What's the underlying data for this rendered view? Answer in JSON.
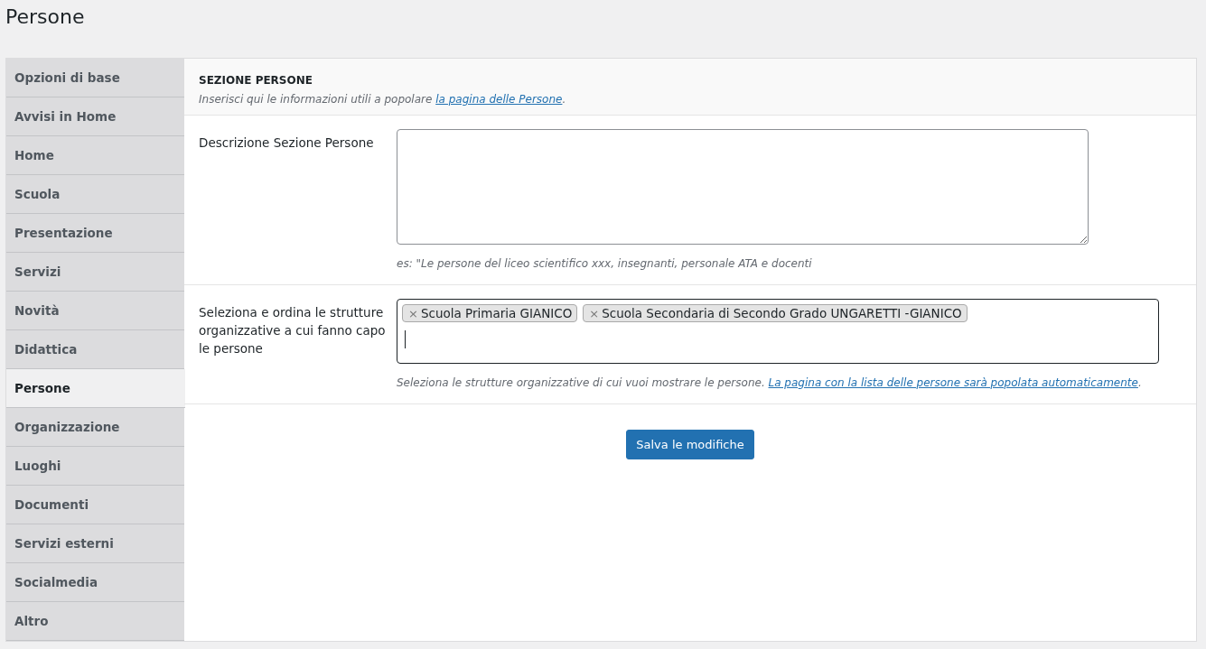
{
  "page_title": "Persone",
  "sidebar": {
    "items": [
      {
        "label": "Opzioni di base",
        "selected": false
      },
      {
        "label": "Avvisi in Home",
        "selected": false
      },
      {
        "label": "Home",
        "selected": false
      },
      {
        "label": "Scuola",
        "selected": false
      },
      {
        "label": "Presentazione",
        "selected": false
      },
      {
        "label": "Servizi",
        "selected": false
      },
      {
        "label": "Novità",
        "selected": false
      },
      {
        "label": "Didattica",
        "selected": false
      },
      {
        "label": "Persone",
        "selected": true
      },
      {
        "label": "Organizzazione",
        "selected": false
      },
      {
        "label": "Luoghi",
        "selected": false
      },
      {
        "label": "Documenti",
        "selected": false
      },
      {
        "label": "Servizi esterni",
        "selected": false
      },
      {
        "label": "Socialmedia",
        "selected": false
      },
      {
        "label": "Altro",
        "selected": false
      }
    ]
  },
  "section": {
    "title": "SEZIONE PERSONE",
    "intro": {
      "text": "Inserisci qui le informazioni utili a popolare ",
      "link": "la pagina delle Persone",
      "end": "."
    }
  },
  "fields": [
    {
      "kind": "textarea",
      "label": "Descrizione Sezione Persone",
      "hint": {
        "text": "es: \"Le persone del liceo scientifico xxx, insegnanti, personale ATA e docenti"
      }
    },
    {
      "kind": "tags",
      "label": "Seleziona e ordina le strutture organizzative a cui fanno capo le persone",
      "tags": [
        {
          "remove": "×",
          "label": "Scuola Primaria GIANICO"
        },
        {
          "remove": "×",
          "label": "Scuola Secondaria di Secondo Grado UNGARETTI -GIANICO"
        }
      ],
      "hint": {
        "text": "Seleziona le strutture organizzative di cui vuoi mostrare le persone. ",
        "link": "La pagina con la lista delle persone sarà popolata automaticamente",
        "end": "."
      }
    }
  ],
  "save_button": "Salva le modifiche"
}
